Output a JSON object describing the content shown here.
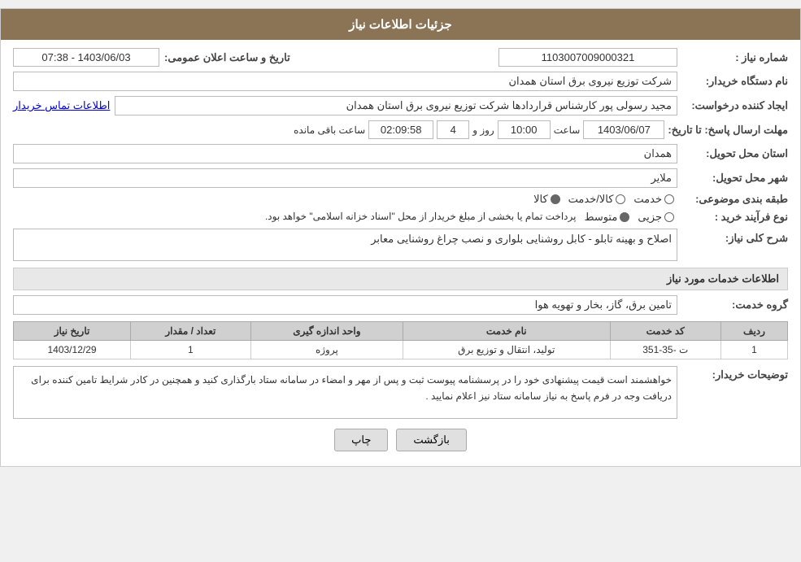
{
  "header": {
    "title": "جزئیات اطلاعات نیاز"
  },
  "fields": {
    "need_number_label": "شماره نیاز :",
    "need_number_value": "1103007009000321",
    "buyer_name_label": "نام دستگاه خریدار:",
    "buyer_name_value": "شرکت توزیع نیروی برق استان همدان",
    "creator_label": "ایجاد کننده درخواست:",
    "creator_value": "مجید رسولی پور کارشناس قراردادها شرکت توزیع نیروی برق استان همدان",
    "creator_link": "اطلاعات تماس خریدار",
    "deadline_label": "مهلت ارسال پاسخ: تا تاریخ:",
    "deadline_date": "1403/06/07",
    "deadline_time_label": "ساعت",
    "deadline_time": "10:00",
    "deadline_days_label": "روز و",
    "deadline_days": "4",
    "deadline_remaining_label": "ساعت باقی مانده",
    "deadline_remaining": "02:09:58",
    "announcement_label": "تاریخ و ساعت اعلان عمومی:",
    "announcement_value": "1403/06/03 - 07:38",
    "province_label": "استان محل تحویل:",
    "province_value": "همدان",
    "city_label": "شهر محل تحویل:",
    "city_value": "ملایر",
    "category_label": "طبقه بندی موضوعی:",
    "category_options": [
      "خدمت",
      "کالا/خدمت",
      "کالا"
    ],
    "category_selected": "کالا",
    "process_label": "نوع فرآیند خرید :",
    "process_options": [
      "جزیی",
      "متوسط"
    ],
    "process_note": "پرداخت تمام یا بخشی از مبلغ خریدار از محل \"اسناد خزانه اسلامی\" خواهد بود.",
    "description_label": "شرح کلی نیاز:",
    "description_value": "اصلاح و بهینه تابلو - کابل روشنایی بلواری و نصب چراغ روشنایی معابر",
    "service_section_title": "اطلاعات خدمات مورد نیاز",
    "service_group_label": "گروه خدمت:",
    "service_group_value": "تامین برق، گاز، بخار و تهویه هوا",
    "table": {
      "headers": [
        "ردیف",
        "کد خدمت",
        "نام خدمت",
        "واحد اندازه گیری",
        "تعداد / مقدار",
        "تاریخ نیاز"
      ],
      "rows": [
        {
          "row": "1",
          "code": "ت -35-351",
          "service": "تولید، انتقال و توزیع برق",
          "unit": "پروژه",
          "qty": "1",
          "date": "1403/12/29"
        }
      ]
    },
    "buyer_notes_label": "توضیحات خریدار:",
    "buyer_notes_value": "خواهشمند است  قیمت پیشنهادی خود را در پرسشنامه پیوست ثبت و پس از مهر و امضاء در سامانه ستاد بارگذاری کنید  و  همچنین  در کادر شرایط تامین کننده برای دریافت وجه در فرم پاسخ به نیاز سامانه ستاد نیز اعلام نمایید .",
    "btn_back": "بازگشت",
    "btn_print": "چاپ"
  }
}
